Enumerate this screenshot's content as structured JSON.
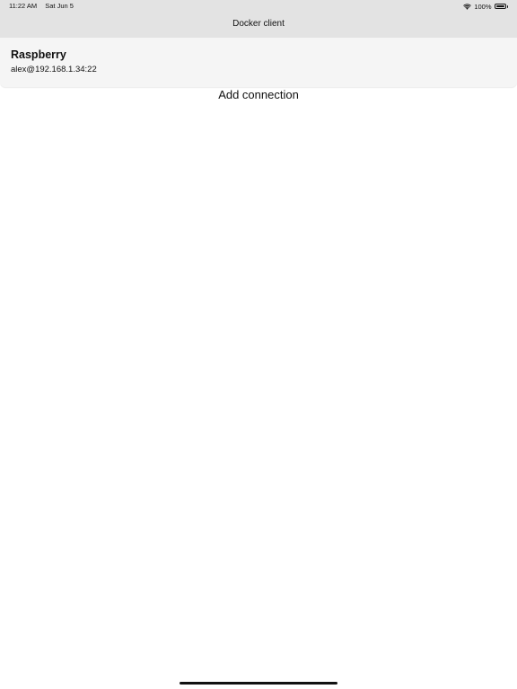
{
  "status_bar": {
    "time": "11:22 AM",
    "date": "Sat Jun 5",
    "battery_percent": "100%",
    "battery_level": 1.0,
    "icons": [
      "wifi-icon",
      "battery-icon"
    ]
  },
  "nav": {
    "title": "Docker client"
  },
  "connections": [
    {
      "name": "Raspberry",
      "address": "alex@192.168.1.34:22"
    }
  ],
  "actions": {
    "add_connection_label": "Add connection"
  },
  "colors": {
    "top_bar_bg": "#e3e3e3",
    "card_bg": "#f5f5f5",
    "page_bg": "#ffffff",
    "text": "#111111"
  }
}
